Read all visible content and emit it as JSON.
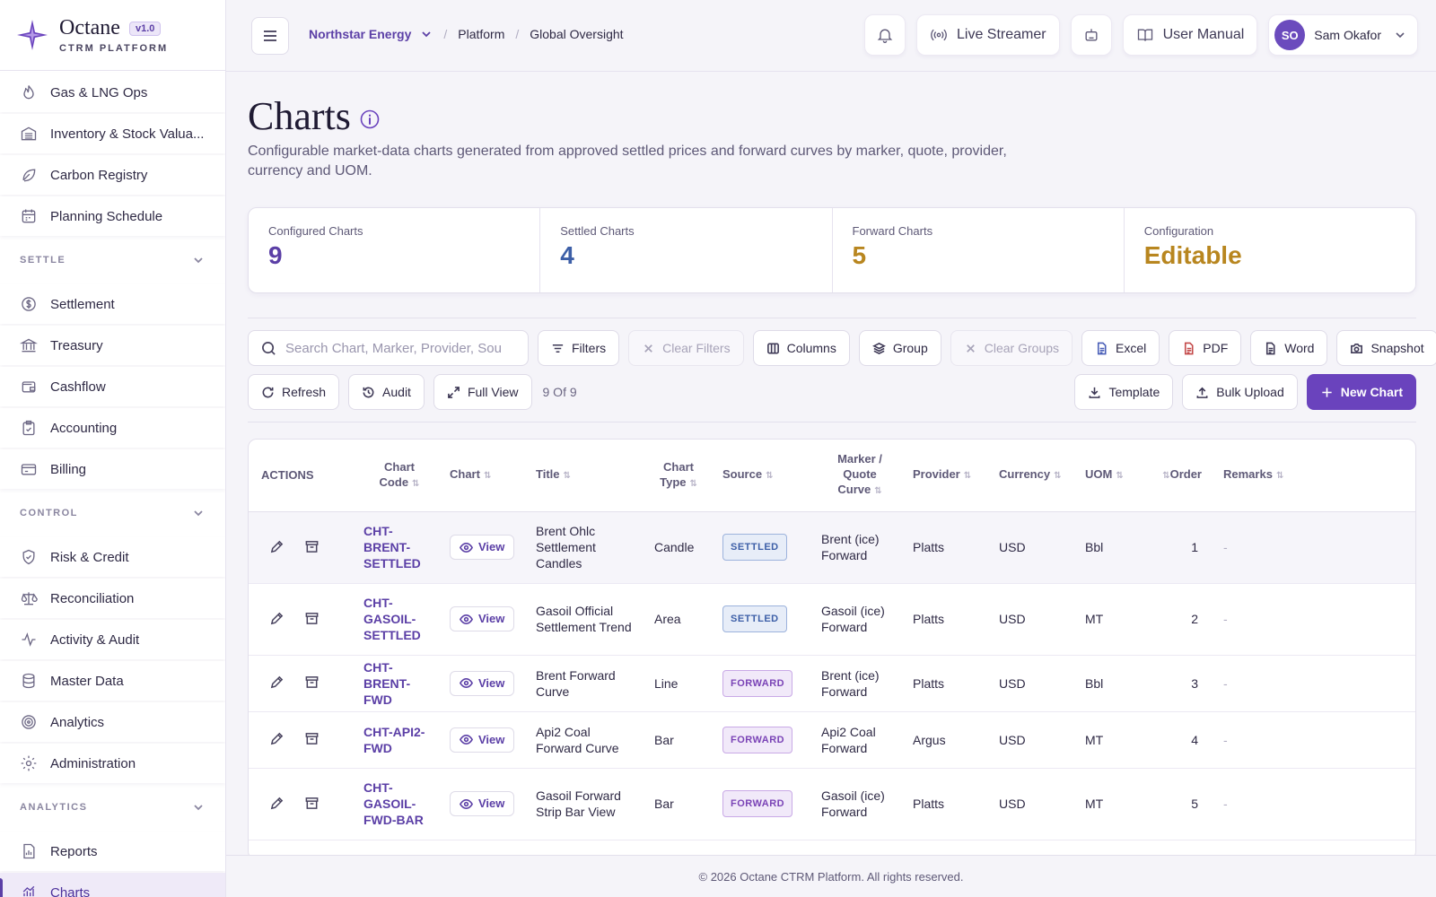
{
  "brand": {
    "name": "Octane",
    "version": "v1.0",
    "subtitle": "CTRM PLATFORM"
  },
  "sidebar": {
    "items_top": [
      {
        "label": "Gas & LNG Ops",
        "icon": "flame-icon"
      },
      {
        "label": "Inventory & Stock Valua...",
        "icon": "warehouse-icon"
      },
      {
        "label": "Carbon Registry",
        "icon": "leaf-icon"
      },
      {
        "label": "Planning Schedule",
        "icon": "calendar-icon"
      }
    ],
    "section_settle": "SETTLE",
    "items_settle": [
      {
        "label": "Settlement",
        "icon": "dollar-circle-icon"
      },
      {
        "label": "Treasury",
        "icon": "bank-icon"
      },
      {
        "label": "Cashflow",
        "icon": "wallet-icon"
      },
      {
        "label": "Accounting",
        "icon": "clipboard-check-icon"
      },
      {
        "label": "Billing",
        "icon": "credit-card-icon"
      }
    ],
    "section_control": "CONTROL",
    "items_control": [
      {
        "label": "Risk & Credit",
        "icon": "shield-check-icon"
      },
      {
        "label": "Reconciliation",
        "icon": "scale-icon"
      },
      {
        "label": "Activity & Audit",
        "icon": "activity-icon"
      },
      {
        "label": "Master Data",
        "icon": "database-icon"
      },
      {
        "label": "Analytics",
        "icon": "target-icon"
      },
      {
        "label": "Administration",
        "icon": "gear-icon"
      }
    ],
    "section_analytics": "ANALYTICS",
    "items_analytics": [
      {
        "label": "Reports",
        "icon": "report-icon"
      },
      {
        "label": "Charts",
        "icon": "chart-icon",
        "active": true
      }
    ]
  },
  "header": {
    "org": "Northstar Energy",
    "crumb_platform": "Platform",
    "crumb_page": "Global Oversight",
    "live_streamer": "Live Streamer",
    "user_manual": "User Manual",
    "user_initials": "SO",
    "user_name": "Sam Okafor"
  },
  "page": {
    "title": "Charts",
    "description": "Configurable market-data charts generated from approved settled prices and forward curves by marker, quote, provider, currency and UOM."
  },
  "stats": [
    {
      "label": "Configured Charts",
      "value": "9",
      "color": "#5b3fa6"
    },
    {
      "label": "Settled Charts",
      "value": "4",
      "color": "#3d5fa7"
    },
    {
      "label": "Forward Charts",
      "value": "5",
      "color": "#b8861f"
    },
    {
      "label": "Configuration",
      "value": "Editable",
      "color": "#b8861f"
    }
  ],
  "toolbar": {
    "search_placeholder": "Search Chart, Marker, Provider, Sou",
    "filters": "Filters",
    "clear_filters": "Clear Filters",
    "columns": "Columns",
    "group": "Group",
    "clear_groups": "Clear Groups",
    "excel": "Excel",
    "pdf": "PDF",
    "word": "Word",
    "snapshot": "Snapshot",
    "refresh": "Refresh",
    "audit": "Audit",
    "full_view": "Full View",
    "count": "9 Of 9",
    "template": "Template",
    "bulk_upload": "Bulk Upload",
    "new_chart": "New Chart"
  },
  "table": {
    "headers": {
      "actions": "ACTIONS",
      "chart_code": "Chart Code",
      "chart": "Chart",
      "title": "Title",
      "chart_type": "Chart Type",
      "source": "Source",
      "marker": "Marker / Quote Curve",
      "provider": "Provider",
      "currency": "Currency",
      "uom": "UOM",
      "order": "Order",
      "remarks": "Remarks"
    },
    "view_label": "View",
    "rows": [
      {
        "code": "CHT-BRENT-SETTLED",
        "title": "Brent Ohlc Settlement Candles",
        "type": "Candle",
        "source": "SETTLED",
        "marker": "Brent (ice) Forward",
        "provider": "Platts",
        "currency": "USD",
        "uom": "Bbl",
        "order": "1",
        "remarks": "-"
      },
      {
        "code": "CHT-GASOIL-SETTLED",
        "title": "Gasoil Official Settlement Trend",
        "type": "Area",
        "source": "SETTLED",
        "marker": "Gasoil (ice) Forward",
        "provider": "Platts",
        "currency": "USD",
        "uom": "MT",
        "order": "2",
        "remarks": "-"
      },
      {
        "code": "CHT-BRENT-FWD",
        "title": "Brent Forward Curve",
        "type": "Line",
        "source": "FORWARD",
        "marker": "Brent (ice) Forward",
        "provider": "Platts",
        "currency": "USD",
        "uom": "Bbl",
        "order": "3",
        "remarks": "-"
      },
      {
        "code": "CHT-API2-FWD",
        "title": "Api2 Coal Forward Curve",
        "type": "Bar",
        "source": "FORWARD",
        "marker": "Api2 Coal Forward",
        "provider": "Argus",
        "currency": "USD",
        "uom": "MT",
        "order": "4",
        "remarks": "-"
      },
      {
        "code": "CHT-GASOIL-FWD-BAR",
        "title": "Gasoil Forward Strip Bar View",
        "type": "Bar",
        "source": "FORWARD",
        "marker": "Gasoil (ice) Forward",
        "provider": "Platts",
        "currency": "USD",
        "uom": "MT",
        "order": "5",
        "remarks": "-"
      }
    ]
  },
  "footer": "© 2026 Octane CTRM Platform. All rights reserved."
}
